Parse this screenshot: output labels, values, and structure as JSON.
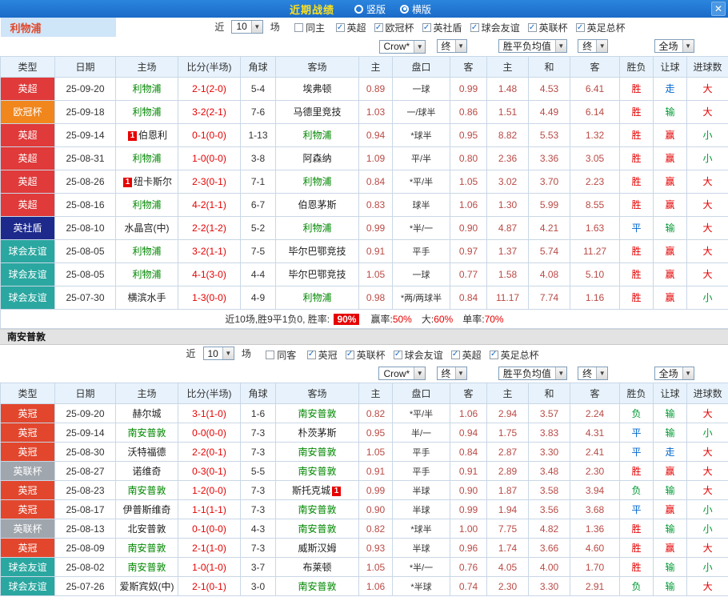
{
  "titlebar": {
    "title": "近期战绩",
    "vertical": "竖版",
    "horizontal": "横版",
    "close": "✕"
  },
  "filter_labels": {
    "near": "近",
    "count": "10",
    "games": "场"
  },
  "dropdowns": {
    "source": "Crow*",
    "final": "终",
    "europe": "胜平负均值",
    "scope": "全场"
  },
  "columns": [
    "类型",
    "日期",
    "主场",
    "比分(半场)",
    "角球",
    "客场",
    "主",
    "盘口",
    "客",
    "主",
    "和",
    "客",
    "胜负",
    "让球",
    "进球数"
  ],
  "league_colors": {
    "英超": "#e03a3a",
    "欧冠杯": "#f0861c",
    "英社盾": "#1d2a8c",
    "球会友谊": "#2aa7a0",
    "英冠": "#e2472e",
    "英联杯": "#a0a6ad"
  },
  "status_colors": {
    "r": "#e60000",
    "g": "#009933",
    "b": "#0066cc"
  },
  "sections": [
    {
      "team": "利物浦",
      "same_label": "同主",
      "leagues": [
        "英超",
        "欧冠杯",
        "英社盾",
        "球会友谊",
        "英联杯",
        "英足总杯"
      ],
      "rows": [
        {
          "league": "英超",
          "date": "25-09-20",
          "home": "利物浦",
          "home_self": true,
          "score": "2-1(2-0)",
          "corner": "5-4",
          "away": "埃弗顿",
          "ah": [
            "0.89",
            "一球",
            "0.99"
          ],
          "eu": [
            "1.48",
            "4.53",
            "6.41"
          ],
          "res": [
            "胜",
            "r"
          ],
          "let": [
            "走",
            "b"
          ],
          "goal": [
            "大",
            "r"
          ]
        },
        {
          "league": "欧冠杯",
          "date": "25-09-18",
          "home": "利物浦",
          "home_self": true,
          "score": "3-2(2-1)",
          "corner": "7-6",
          "away": "马德里竞技",
          "ah": [
            "1.03",
            "一/球半",
            "0.86"
          ],
          "eu": [
            "1.51",
            "4.49",
            "6.14"
          ],
          "res": [
            "胜",
            "r"
          ],
          "let": [
            "输",
            "g"
          ],
          "goal": [
            "大",
            "r"
          ]
        },
        {
          "league": "英超",
          "date": "25-09-14",
          "home": "伯恩利",
          "home_badge": "1",
          "score": "0-1(0-0)",
          "corner": "1-13",
          "away": "利物浦",
          "away_self": true,
          "ah": [
            "0.94",
            "*球半",
            "0.95"
          ],
          "eu": [
            "8.82",
            "5.53",
            "1.32"
          ],
          "res": [
            "胜",
            "r"
          ],
          "let": [
            "赢",
            "r"
          ],
          "goal": [
            "小",
            "g"
          ]
        },
        {
          "league": "英超",
          "date": "25-08-31",
          "home": "利物浦",
          "home_self": true,
          "score": "1-0(0-0)",
          "corner": "3-8",
          "away": "阿森纳",
          "ah": [
            "1.09",
            "平/半",
            "0.80"
          ],
          "eu": [
            "2.36",
            "3.36",
            "3.05"
          ],
          "res": [
            "胜",
            "r"
          ],
          "let": [
            "赢",
            "r"
          ],
          "goal": [
            "小",
            "g"
          ]
        },
        {
          "league": "英超",
          "date": "25-08-26",
          "home": "纽卡斯尔",
          "home_badge": "1",
          "score": "2-3(0-1)",
          "corner": "7-1",
          "away": "利物浦",
          "away_self": true,
          "ah": [
            "0.84",
            "*平/半",
            "1.05"
          ],
          "eu": [
            "3.02",
            "3.70",
            "2.23"
          ],
          "res": [
            "胜",
            "r"
          ],
          "let": [
            "赢",
            "r"
          ],
          "goal": [
            "大",
            "r"
          ]
        },
        {
          "league": "英超",
          "date": "25-08-16",
          "home": "利物浦",
          "home_self": true,
          "score": "4-2(1-1)",
          "corner": "6-7",
          "away": "伯恩茅斯",
          "ah": [
            "0.83",
            "球半",
            "1.06"
          ],
          "eu": [
            "1.30",
            "5.99",
            "8.55"
          ],
          "res": [
            "胜",
            "r"
          ],
          "let": [
            "赢",
            "r"
          ],
          "goal": [
            "大",
            "r"
          ]
        },
        {
          "league": "英社盾",
          "date": "25-08-10",
          "home": "水晶宫(中)",
          "score": "2-2(1-2)",
          "corner": "5-2",
          "away": "利物浦",
          "away_self": true,
          "ah": [
            "0.99",
            "*半/一",
            "0.90"
          ],
          "eu": [
            "4.87",
            "4.21",
            "1.63"
          ],
          "res": [
            "平",
            "b"
          ],
          "let": [
            "输",
            "g"
          ],
          "goal": [
            "大",
            "r"
          ]
        },
        {
          "league": "球会友谊",
          "date": "25-08-05",
          "home": "利物浦",
          "home_self": true,
          "score": "3-2(1-1)",
          "corner": "7-5",
          "away": "毕尔巴鄂竞技",
          "ah": [
            "0.91",
            "平手",
            "0.97"
          ],
          "eu": [
            "1.37",
            "5.74",
            "11.27"
          ],
          "res": [
            "胜",
            "r"
          ],
          "let": [
            "赢",
            "r"
          ],
          "goal": [
            "大",
            "r"
          ]
        },
        {
          "league": "球会友谊",
          "date": "25-08-05",
          "home": "利物浦",
          "home_self": true,
          "score": "4-1(3-0)",
          "corner": "4-4",
          "away": "毕尔巴鄂竞技",
          "ah": [
            "1.05",
            "一球",
            "0.77"
          ],
          "eu": [
            "1.58",
            "4.08",
            "5.10"
          ],
          "res": [
            "胜",
            "r"
          ],
          "let": [
            "赢",
            "r"
          ],
          "goal": [
            "大",
            "r"
          ]
        },
        {
          "league": "球会友谊",
          "date": "25-07-30",
          "home": "横滨水手",
          "score": "1-3(0-0)",
          "corner": "4-9",
          "away": "利物浦",
          "away_self": true,
          "ah": [
            "0.98",
            "*两/两球半",
            "0.84"
          ],
          "eu": [
            "11.17",
            "7.74",
            "1.16"
          ],
          "res": [
            "胜",
            "r"
          ],
          "let": [
            "赢",
            "r"
          ],
          "goal": [
            "小",
            "g"
          ]
        }
      ],
      "summary": {
        "prefix": "近10场,胜9平1负0, 胜率: ",
        "win_rate": "90%",
        "parts": [
          {
            "label": "赢率:",
            "value": "50%"
          },
          {
            "label": "大:",
            "value": "60%"
          },
          {
            "label": "单率:",
            "value": "70%"
          }
        ]
      }
    },
    {
      "team": "南安普敦",
      "same_label": "同客",
      "leagues": [
        "英冠",
        "英联杯",
        "球会友谊",
        "英超",
        "英足总杯"
      ],
      "rows": [
        {
          "league": "英冠",
          "date": "25-09-20",
          "home": "赫尔城",
          "score": "3-1(1-0)",
          "corner": "1-6",
          "away": "南安普敦",
          "away_self": true,
          "ah": [
            "0.82",
            "*平/半",
            "1.06"
          ],
          "eu": [
            "2.94",
            "3.57",
            "2.24"
          ],
          "res": [
            "负",
            "g"
          ],
          "let": [
            "输",
            "g"
          ],
          "goal": [
            "大",
            "r"
          ]
        },
        {
          "league": "英冠",
          "date": "25-09-14",
          "home": "南安普敦",
          "home_self": true,
          "score": "0-0(0-0)",
          "corner": "7-3",
          "away": "朴茨茅斯",
          "ah": [
            "0.95",
            "半/一",
            "0.94"
          ],
          "eu": [
            "1.75",
            "3.83",
            "4.31"
          ],
          "res": [
            "平",
            "b"
          ],
          "let": [
            "输",
            "g"
          ],
          "goal": [
            "小",
            "g"
          ]
        },
        {
          "league": "英冠",
          "date": "25-08-30",
          "home": "沃特福德",
          "score": "2-2(0-1)",
          "corner": "7-3",
          "away": "南安普敦",
          "away_self": true,
          "ah": [
            "1.05",
            "平手",
            "0.84"
          ],
          "eu": [
            "2.87",
            "3.30",
            "2.41"
          ],
          "res": [
            "平",
            "b"
          ],
          "let": [
            "走",
            "b"
          ],
          "goal": [
            "大",
            "r"
          ]
        },
        {
          "league": "英联杯",
          "date": "25-08-27",
          "home": "诺维奇",
          "score": "0-3(0-1)",
          "corner": "5-5",
          "away": "南安普敦",
          "away_self": true,
          "ah": [
            "0.91",
            "平手",
            "0.91"
          ],
          "eu": [
            "2.89",
            "3.48",
            "2.30"
          ],
          "res": [
            "胜",
            "r"
          ],
          "let": [
            "赢",
            "r"
          ],
          "goal": [
            "大",
            "r"
          ]
        },
        {
          "league": "英冠",
          "date": "25-08-23",
          "home": "南安普敦",
          "home_self": true,
          "score": "1-2(0-0)",
          "corner": "7-3",
          "away": "斯托克城",
          "away_badge": "1",
          "ah": [
            "0.99",
            "半球",
            "0.90"
          ],
          "eu": [
            "1.87",
            "3.58",
            "3.94"
          ],
          "res": [
            "负",
            "g"
          ],
          "let": [
            "输",
            "g"
          ],
          "goal": [
            "大",
            "r"
          ]
        },
        {
          "league": "英冠",
          "date": "25-08-17",
          "home": "伊普斯维奇",
          "score": "1-1(1-1)",
          "corner": "7-3",
          "away": "南安普敦",
          "away_self": true,
          "ah": [
            "0.90",
            "半球",
            "0.99"
          ],
          "eu": [
            "1.94",
            "3.56",
            "3.68"
          ],
          "res": [
            "平",
            "b"
          ],
          "let": [
            "赢",
            "r"
          ],
          "goal": [
            "小",
            "g"
          ]
        },
        {
          "league": "英联杯",
          "date": "25-08-13",
          "home": "北安普敦",
          "score": "0-1(0-0)",
          "corner": "4-3",
          "away": "南安普敦",
          "away_self": true,
          "ah": [
            "0.82",
            "*球半",
            "1.00"
          ],
          "eu": [
            "7.75",
            "4.82",
            "1.36"
          ],
          "res": [
            "胜",
            "r"
          ],
          "let": [
            "输",
            "g"
          ],
          "goal": [
            "小",
            "g"
          ]
        },
        {
          "league": "英冠",
          "date": "25-08-09",
          "home": "南安普敦",
          "home_self": true,
          "score": "2-1(1-0)",
          "corner": "7-3",
          "away": "威斯汉姆",
          "ah": [
            "0.93",
            "半球",
            "0.96"
          ],
          "eu": [
            "1.74",
            "3.66",
            "4.60"
          ],
          "res": [
            "胜",
            "r"
          ],
          "let": [
            "赢",
            "r"
          ],
          "goal": [
            "大",
            "r"
          ]
        },
        {
          "league": "球会友谊",
          "date": "25-08-02",
          "home": "南安普敦",
          "home_self": true,
          "score": "1-0(1-0)",
          "corner": "3-7",
          "away": "布莱顿",
          "ah": [
            "1.05",
            "*半/一",
            "0.76"
          ],
          "eu": [
            "4.05",
            "4.00",
            "1.70"
          ],
          "res": [
            "胜",
            "r"
          ],
          "let": [
            "输",
            "g"
          ],
          "goal": [
            "小",
            "g"
          ]
        },
        {
          "league": "球会友谊",
          "date": "25-07-26",
          "home": "爱斯宾奴(中)",
          "score": "2-1(0-1)",
          "corner": "3-0",
          "away": "南安普敦",
          "away_self": true,
          "ah": [
            "1.06",
            "*半球",
            "0.74"
          ],
          "eu": [
            "2.30",
            "3.30",
            "2.91"
          ],
          "res": [
            "负",
            "g"
          ],
          "let": [
            "输",
            "g"
          ],
          "goal": [
            "大",
            "r"
          ]
        }
      ]
    }
  ]
}
